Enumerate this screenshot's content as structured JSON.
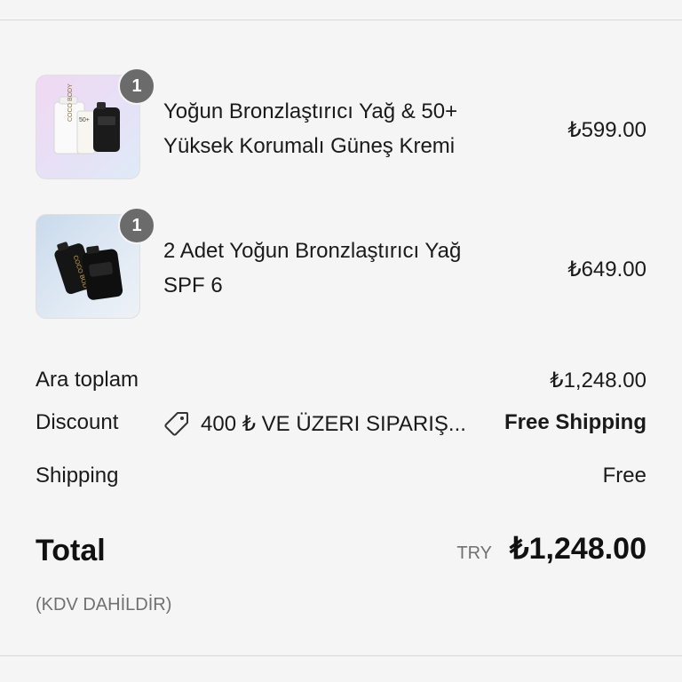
{
  "cart": {
    "items": [
      {
        "quantity": "1",
        "name_line1": "Yoğun Bronzlaştırıcı Yağ & 50+",
        "name_line2": "Yüksek Korumalı Güneş Kremi",
        "price": "₺599.00",
        "image_icon": "product-bundle-sunscreen-oil"
      },
      {
        "quantity": "1",
        "name_line1": "2 Adet Yoğun Bronzlaştırıcı Yağ",
        "name_line2": "SPF 6",
        "price": "₺649.00",
        "image_icon": "product-two-tanning-oils"
      }
    ]
  },
  "summary": {
    "subtotal_label": "Ara toplam",
    "subtotal_value": "₺1,248.00",
    "discount_label": "Discount",
    "discount_code": "400 ₺ VE ÜZERI SIPARIŞ...",
    "discount_icon": "tag-icon",
    "discount_value": "Free Shipping",
    "shipping_label": "Shipping",
    "shipping_value": "Free",
    "total_label": "Total",
    "currency_code": "TRY",
    "total_value": "₺1,248.00",
    "tax_note": "(KDV DAHİLDİR)"
  }
}
